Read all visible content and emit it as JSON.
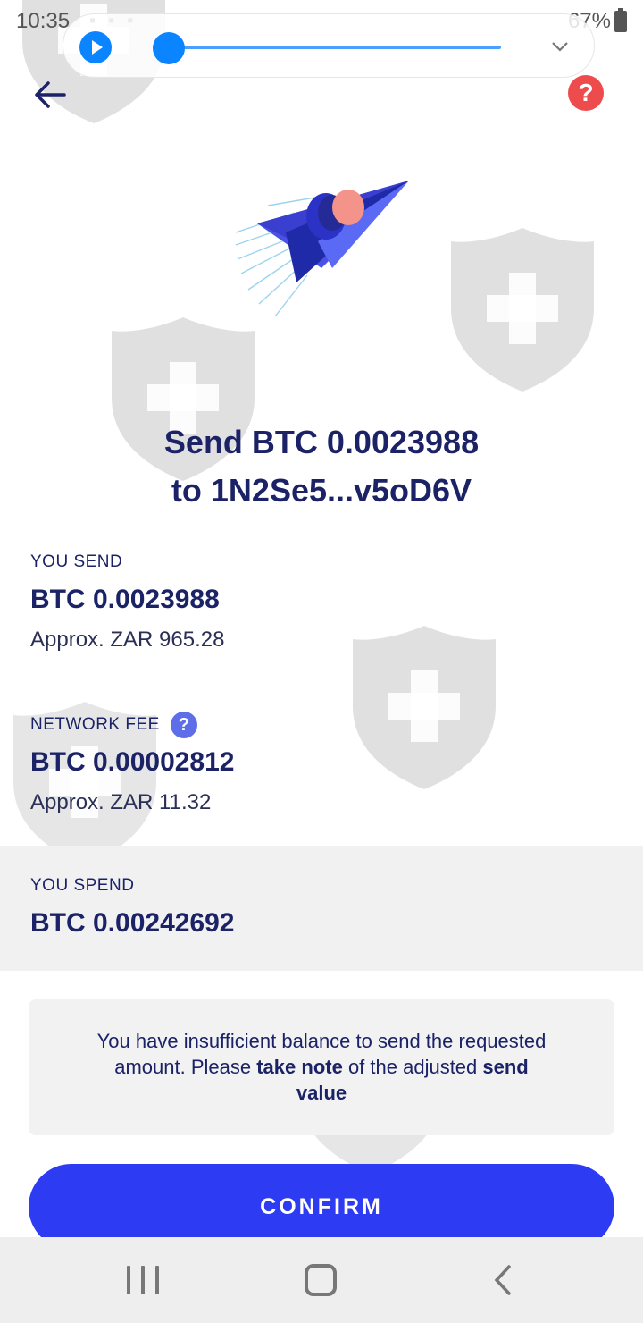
{
  "status_bar": {
    "time": "10:35",
    "battery": "67%"
  },
  "header": {
    "help_symbol": "?"
  },
  "title": {
    "line1": "Send BTC 0.0023988",
    "line2": "to 1N2Se5...v5oD6V"
  },
  "you_send": {
    "label": "YOU SEND",
    "amount": "BTC 0.0023988",
    "approx": "Approx. ZAR 965.28"
  },
  "network_fee": {
    "label": "NETWORK FEE",
    "help_symbol": "?",
    "amount": "BTC 0.00002812",
    "approx": "Approx. ZAR 11.32"
  },
  "you_spend": {
    "label": "YOU SPEND",
    "amount": "BTC 0.00242692"
  },
  "notice": {
    "part1": "You have insufficient balance to send the requested amount. Please ",
    "bold1": "take note",
    "part2": " of the adjusted ",
    "bold2": "send value"
  },
  "confirm": {
    "label": "CONFIRM"
  },
  "colors": {
    "primary": "#2d3cf2",
    "text": "#1b2266",
    "help": "#ee4c4c",
    "fee_help": "#5d6ee8",
    "media": "#0a84ff"
  }
}
